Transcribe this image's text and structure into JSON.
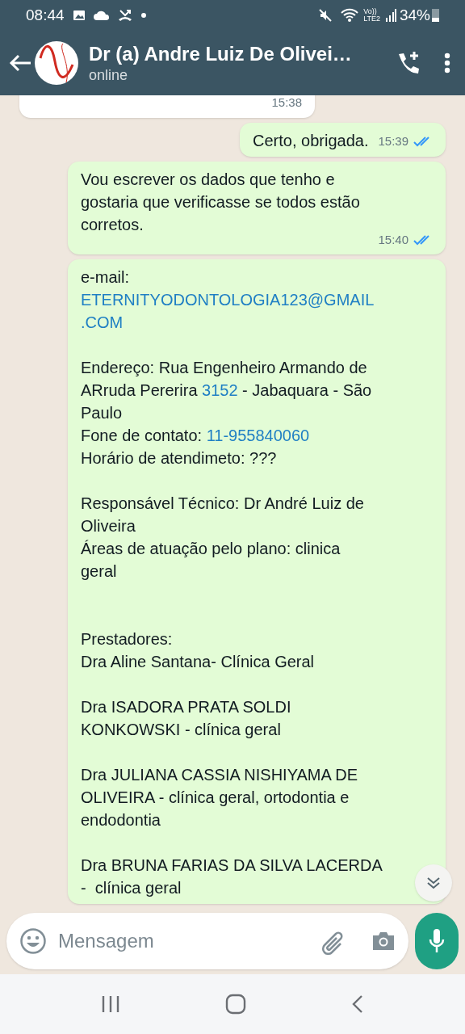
{
  "status_bar": {
    "time": "08:44",
    "network_top": "Vo))",
    "network_bottom": "LTE2",
    "battery": "34%"
  },
  "header": {
    "title": "Dr (a) Andre Luiz De Olivei…",
    "subtitle": "online"
  },
  "messages": [
    {
      "outgoing": false,
      "time": "15:38"
    },
    {
      "outgoing": true,
      "time": "15:39",
      "read": true,
      "lines": [
        {
          "kind": "line",
          "parts": [
            {
              "kind": "text",
              "text": "Certo, obrigada."
            }
          ]
        }
      ]
    },
    {
      "outgoing": true,
      "time": "15:40",
      "read": true,
      "lines": [
        {
          "kind": "line",
          "parts": [
            {
              "kind": "text",
              "text": "Vou escrever os dados que tenho e"
            }
          ]
        },
        {
          "kind": "line",
          "parts": [
            {
              "kind": "text",
              "text": "gostaria que verificasse se todos estão"
            }
          ]
        },
        {
          "kind": "line",
          "parts": [
            {
              "kind": "text",
              "text": "corretos."
            }
          ]
        }
      ]
    },
    {
      "outgoing": true,
      "lines": [
        {
          "kind": "line",
          "parts": [
            {
              "kind": "text",
              "text": "e-mail:"
            }
          ]
        },
        {
          "kind": "line",
          "parts": [
            {
              "kind": "link",
              "text": "ETERNITYODONTOLOGIA123@GMAIL"
            }
          ]
        },
        {
          "kind": "line",
          "parts": [
            {
              "kind": "link",
              "text": ".COM"
            }
          ]
        },
        {
          "kind": "blank"
        },
        {
          "kind": "line",
          "parts": [
            {
              "kind": "text",
              "text": "Endereço: Rua Engenheiro Armando de"
            }
          ]
        },
        {
          "kind": "line",
          "parts": [
            {
              "kind": "text",
              "text": "ARruda Pererira "
            },
            {
              "kind": "link",
              "text": "3152"
            },
            {
              "kind": "text",
              "text": " - Jabaquara - São"
            }
          ]
        },
        {
          "kind": "line",
          "parts": [
            {
              "kind": "text",
              "text": "Paulo"
            }
          ]
        },
        {
          "kind": "line",
          "parts": [
            {
              "kind": "text",
              "text": "Fone de contato: "
            },
            {
              "kind": "link",
              "text": "11-955840060"
            }
          ]
        },
        {
          "kind": "line",
          "parts": [
            {
              "kind": "text",
              "text": "Horário de atendimeto: ???"
            }
          ]
        },
        {
          "kind": "blank"
        },
        {
          "kind": "line",
          "parts": [
            {
              "kind": "text",
              "text": "Responsável Técnico: Dr André Luiz de"
            }
          ]
        },
        {
          "kind": "line",
          "parts": [
            {
              "kind": "text",
              "text": "Oliveira"
            }
          ]
        },
        {
          "kind": "line",
          "parts": [
            {
              "kind": "text",
              "text": "Áreas de atuação pelo plano: clinica"
            }
          ]
        },
        {
          "kind": "line",
          "parts": [
            {
              "kind": "text",
              "text": "geral"
            }
          ]
        },
        {
          "kind": "blank"
        },
        {
          "kind": "blank"
        },
        {
          "kind": "line",
          "parts": [
            {
              "kind": "text",
              "text": "Prestadores:"
            }
          ]
        },
        {
          "kind": "line",
          "parts": [
            {
              "kind": "text",
              "text": "Dra Aline Santana- Clínica Geral"
            }
          ]
        },
        {
          "kind": "blank"
        },
        {
          "kind": "line",
          "parts": [
            {
              "kind": "text",
              "text": "Dra ISADORA PRATA SOLDI"
            }
          ]
        },
        {
          "kind": "line",
          "parts": [
            {
              "kind": "text",
              "text": "KONKOWSKI - clínica geral"
            }
          ]
        },
        {
          "kind": "blank"
        },
        {
          "kind": "line",
          "parts": [
            {
              "kind": "text",
              "text": "Dra JULIANA CASSIA NISHIYAMA DE"
            }
          ]
        },
        {
          "kind": "line",
          "parts": [
            {
              "kind": "text",
              "text": "OLIVEIRA - clínica geral, ortodontia e"
            }
          ]
        },
        {
          "kind": "line",
          "parts": [
            {
              "kind": "text",
              "text": "endodontia"
            }
          ]
        },
        {
          "kind": "blank"
        },
        {
          "kind": "line",
          "parts": [
            {
              "kind": "text",
              "text": "Dra BRUNA FARIAS DA SILVA LACERDA"
            }
          ]
        },
        {
          "kind": "line",
          "parts": [
            {
              "kind": "text",
              "text": "-  clínica geral"
            }
          ]
        }
      ]
    }
  ],
  "composer": {
    "placeholder": "Mensagem"
  }
}
